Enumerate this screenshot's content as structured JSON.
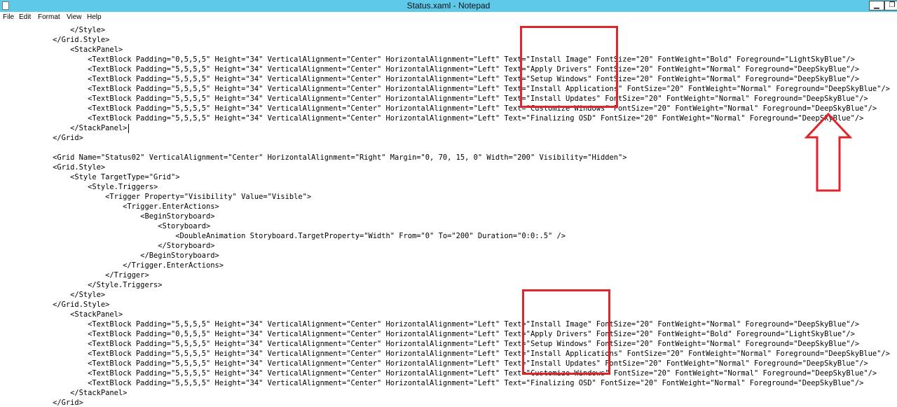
{
  "window": {
    "title": "Status.xaml - Notepad",
    "minimize_glyph": "▁",
    "restore_glyph": "❐"
  },
  "menu": [
    "File",
    "Edit",
    "Format",
    "View",
    "Help"
  ],
  "code_lines": [
    "                </Style>",
    "            </Grid.Style>",
    "                <StackPanel>",
    "                    <TextBlock Padding=\"0,5,5,5\" Height=\"34\" VerticalAlignment=\"Center\" HorizontalAlignment=\"Left\" Text=\"Install Image\" FontSize=\"20\" FontWeight=\"Bold\" Foreground=\"LightSkyBlue\"/>",
    "                    <TextBlock Padding=\"5,5,5,5\" Height=\"34\" VerticalAlignment=\"Center\" HorizontalAlignment=\"Left\" Text=\"Apply Drivers\" FontSize=\"20\" FontWeight=\"Normal\" Foreground=\"DeepSkyBlue\"/>",
    "                    <TextBlock Padding=\"5,5,5,5\" Height=\"34\" VerticalAlignment=\"Center\" HorizontalAlignment=\"Left\" Text=\"Setup Windows\" FontSize=\"20\" FontWeight=\"Normal\" Foreground=\"DeepSkyBlue\"/>",
    "                    <TextBlock Padding=\"5,5,5,5\" Height=\"34\" VerticalAlignment=\"Center\" HorizontalAlignment=\"Left\" Text=\"Install Applications\" FontSize=\"20\" FontWeight=\"Normal\" Foreground=\"DeepSkyBlue\"/>",
    "                    <TextBlock Padding=\"5,5,5,5\" Height=\"34\" VerticalAlignment=\"Center\" HorizontalAlignment=\"Left\" Text=\"Install Updates\" FontSize=\"20\" FontWeight=\"Normal\" Foreground=\"DeepSkyBlue\"/>",
    "                    <TextBlock Padding=\"5,5,5,5\" Height=\"34\" VerticalAlignment=\"Center\" HorizontalAlignment=\"Left\" Text=\"Customize Windows\" FontSize=\"20\" FontWeight=\"Normal\" Foreground=\"DeepSkyBlue\"/>",
    "                    <TextBlock Padding=\"5,5,5,5\" Height=\"34\" VerticalAlignment=\"Center\" HorizontalAlignment=\"Left\" Text=\"Finalizing OSD\" FontSize=\"20\" FontWeight=\"Normal\" Foreground=\"DeepSkyBlue\"/>",
    "                </StackPanel>",
    "            </Grid>",
    "",
    "            <Grid Name=\"Status02\" VerticalAlignment=\"Center\" HorizontalAlignment=\"Right\" Margin=\"0, 70, 15, 0\" Width=\"200\" Visibility=\"Hidden\">",
    "            <Grid.Style>",
    "                <Style TargetType=\"Grid\">",
    "                    <Style.Triggers>",
    "                        <Trigger Property=\"Visibility\" Value=\"Visible\">",
    "                            <Trigger.EnterActions>",
    "                                <BeginStoryboard>",
    "                                    <Storyboard>",
    "                                        <DoubleAnimation Storyboard.TargetProperty=\"Width\" From=\"0\" To=\"200\" Duration=\"0:0:.5\" />",
    "                                    </Storyboard>",
    "                                </BeginStoryboard>",
    "                            </Trigger.EnterActions>",
    "                        </Trigger>",
    "                    </Style.Triggers>",
    "                </Style>",
    "            </Grid.Style>",
    "                <StackPanel>",
    "                    <TextBlock Padding=\"5,5,5,5\" Height=\"34\" VerticalAlignment=\"Center\" HorizontalAlignment=\"Left\" Text=\"Install Image\" FontSize=\"20\" FontWeight=\"Normal\" Foreground=\"DeepSkyBlue\"/>",
    "                    <TextBlock Padding=\"0,5,5,5\" Height=\"34\" VerticalAlignment=\"Center\" HorizontalAlignment=\"Left\" Text=\"Apply Drivers\" FontSize=\"20\" FontWeight=\"Bold\" Foreground=\"LightSkyBlue\"/>",
    "                    <TextBlock Padding=\"5,5,5,5\" Height=\"34\" VerticalAlignment=\"Center\" HorizontalAlignment=\"Left\" Text=\"Setup Windows\" FontSize=\"20\" FontWeight=\"Normal\" Foreground=\"DeepSkyBlue\"/>",
    "                    <TextBlock Padding=\"5,5,5,5\" Height=\"34\" VerticalAlignment=\"Center\" HorizontalAlignment=\"Left\" Text=\"Install Applications\" FontSize=\"20\" FontWeight=\"Normal\" Foreground=\"DeepSkyBlue\"/>",
    "                    <TextBlock Padding=\"5,5,5,5\" Height=\"34\" VerticalAlignment=\"Center\" HorizontalAlignment=\"Left\" Text=\"Install Updates\" FontSize=\"20\" FontWeight=\"Normal\" Foreground=\"DeepSkyBlue\"/>",
    "                    <TextBlock Padding=\"5,5,5,5\" Height=\"34\" VerticalAlignment=\"Center\" HorizontalAlignment=\"Left\" Text=\"Customize Windows\" FontSize=\"20\" FontWeight=\"Normal\" Foreground=\"DeepSkyBlue\"/>",
    "                    <TextBlock Padding=\"5,5,5,5\" Height=\"34\" VerticalAlignment=\"Center\" HorizontalAlignment=\"Left\" Text=\"Finalizing OSD\" FontSize=\"20\" FontWeight=\"Normal\" Foreground=\"DeepSkyBlue\"/>",
    "                </StackPanel>",
    "            </Grid>"
  ],
  "colors": {
    "titlebar": "#5ec9e8",
    "annotation": "#e0242c"
  }
}
